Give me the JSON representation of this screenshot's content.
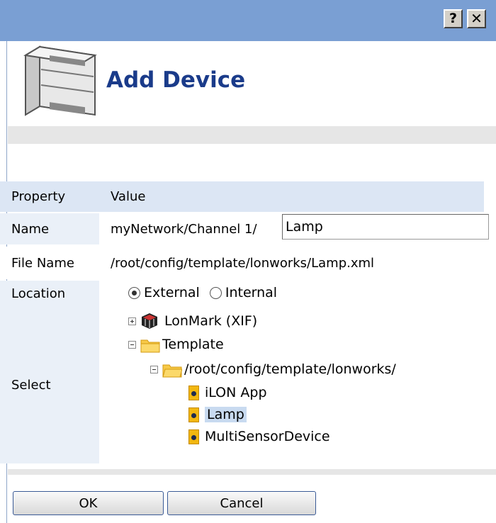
{
  "title_bar": {
    "help_label": "?",
    "close_label": "✕"
  },
  "header": {
    "title": "Add Device"
  },
  "grid": {
    "header": {
      "property": "Property",
      "value": "Value"
    },
    "name": {
      "label": "Name",
      "prefix": "myNetwork/Channel 1/",
      "value": "Lamp"
    },
    "file_name": {
      "label": "File Name",
      "value": "/root/config/template/lonworks/Lamp.xml"
    },
    "location": {
      "label": "Location",
      "options": [
        "External",
        "Internal"
      ],
      "selected": "External"
    },
    "select": {
      "label": "Select"
    }
  },
  "tree": {
    "lonmark": "LonMark (XIF)",
    "template": "Template",
    "template_path": "/root/config/template/lonworks/",
    "items": [
      "iLON App",
      "Lamp",
      "MultiSensorDevice"
    ],
    "selected_item": "Lamp"
  },
  "buttons": {
    "ok": "OK",
    "cancel": "Cancel"
  },
  "colors": {
    "title_bar": "#7a9fd3",
    "header_text": "#1a3b8a",
    "grid_label_bg": "#dce6f4",
    "selection": "#c8daf0"
  }
}
